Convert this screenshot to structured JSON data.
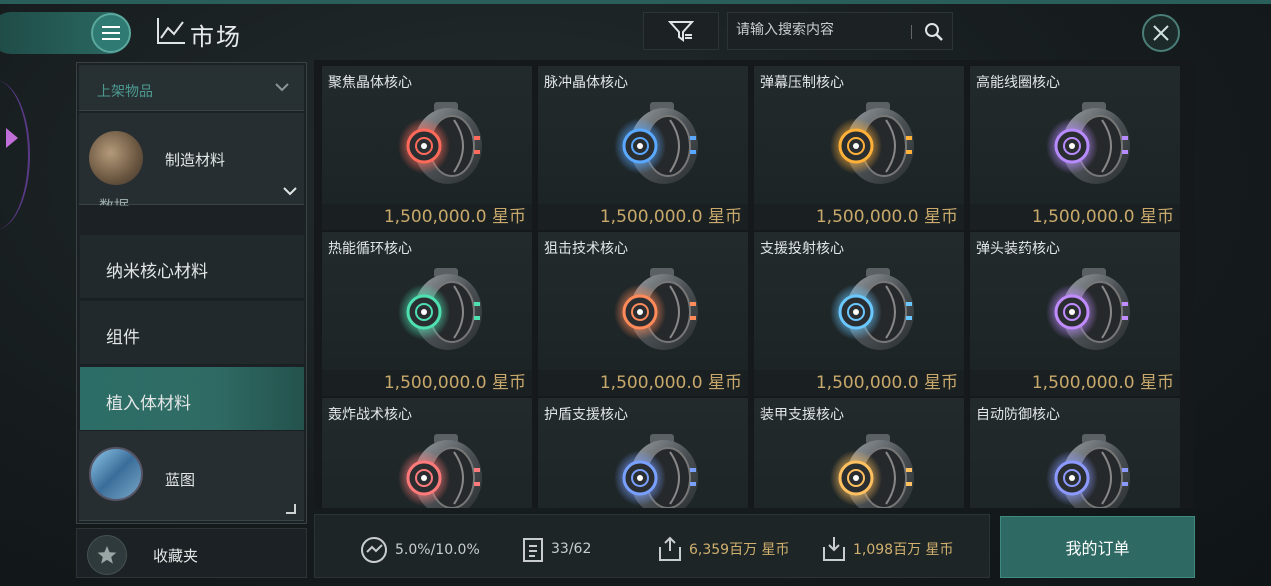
{
  "header": {
    "title": "市场",
    "search_placeholder": "请输入搜索内容"
  },
  "sidebar": {
    "dropdown_label": "上架物品",
    "category_top": "制造材料",
    "partial_item": "数据",
    "items": [
      {
        "label": "纳米核心材料",
        "active": false
      },
      {
        "label": "组件",
        "active": false
      },
      {
        "label": "植入体材料",
        "active": true
      }
    ],
    "category_bottom": "蓝图",
    "favorites_label": "收藏夹"
  },
  "items": [
    {
      "name": "聚焦晶体核心",
      "price": "1,500,000.0 星币",
      "glow": "#ff6a5a"
    },
    {
      "name": "脉冲晶体核心",
      "price": "1,500,000.0 星币",
      "glow": "#5aa8ff"
    },
    {
      "name": "弹幕压制核心",
      "price": "1,500,000.0 星币",
      "glow": "#ffb13a"
    },
    {
      "name": "高能线圈核心",
      "price": "1,500,000.0 星币",
      "glow": "#b88cff"
    },
    {
      "name": "热能循环核心",
      "price": "1,500,000.0 星币",
      "glow": "#4fe0b0"
    },
    {
      "name": "狙击技术核心",
      "price": "1,500,000.0 星币",
      "glow": "#ff8a5a"
    },
    {
      "name": "支援投射核心",
      "price": "1,500,000.0 星币",
      "glow": "#6ac8ff"
    },
    {
      "name": "弹头装药核心",
      "price": "1,500,000.0 星币",
      "glow": "#c08cff"
    },
    {
      "name": "轰炸战术核心",
      "price": "",
      "glow": "#ff7a7a"
    },
    {
      "name": "护盾支援核心",
      "price": "",
      "glow": "#7aa0ff"
    },
    {
      "name": "装甲支援核心",
      "price": "",
      "glow": "#ffc060"
    },
    {
      "name": "自动防御核心",
      "price": "",
      "glow": "#8c9aff"
    }
  ],
  "stats": {
    "tax": "5.0%/10.0%",
    "orders": "33/62",
    "sell": "6,359百万 星币",
    "buy": "1,098百万 星币"
  },
  "order_button": "我的订单"
}
